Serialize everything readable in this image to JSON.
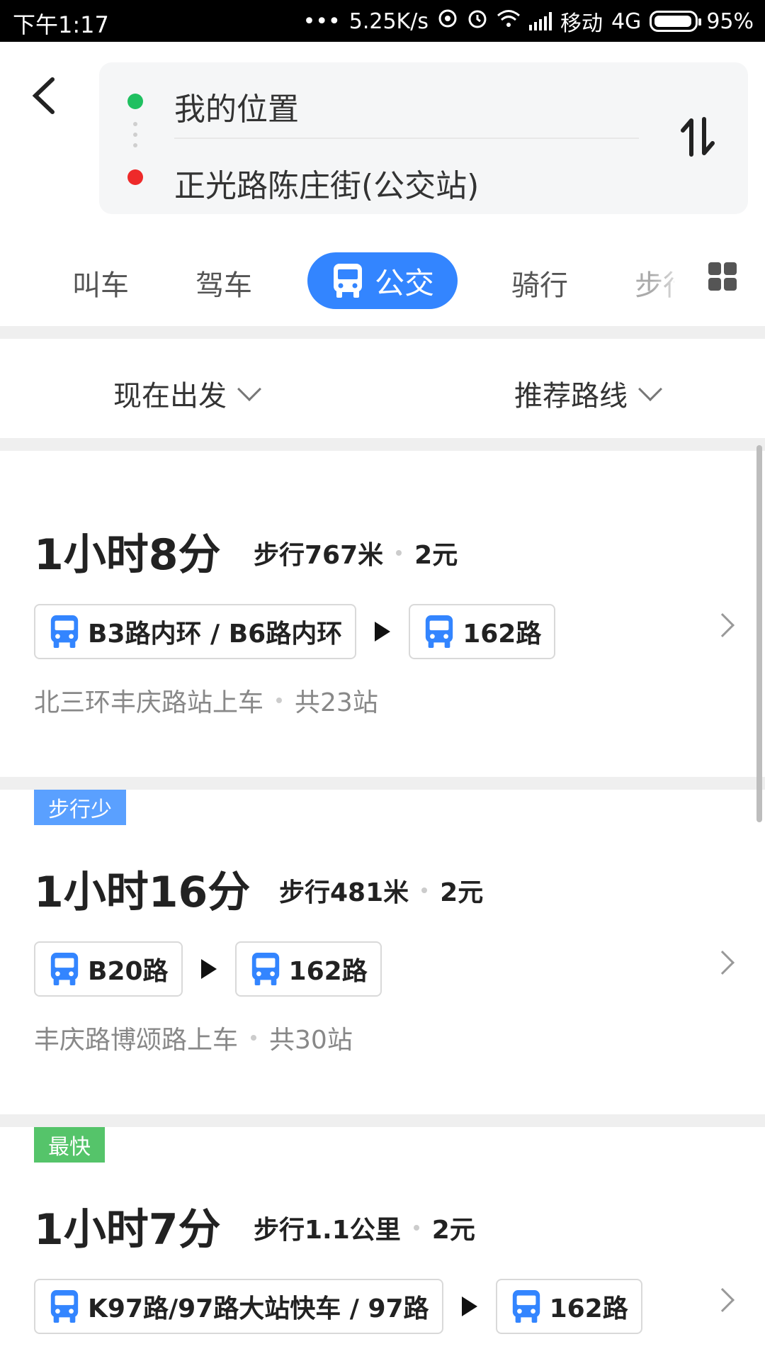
{
  "status_bar": {
    "time": "下午1:17",
    "dots": "•••",
    "speed": "5.25K/s",
    "carrier": "移动",
    "network": "4G",
    "battery": "95%"
  },
  "route": {
    "from": "我的位置",
    "to": "正光路陈庄街(公交站)"
  },
  "mode_tabs": [
    {
      "label": "叫车"
    },
    {
      "label": "驾车"
    },
    {
      "label": "公交"
    },
    {
      "label": "骑行"
    },
    {
      "label": "步行"
    }
  ],
  "filters": {
    "depart": "现在出发",
    "strategy": "推荐路线"
  },
  "routes": [
    {
      "tag": "",
      "duration": "1小时8分",
      "walk": "步行767米",
      "price": "2元",
      "lines": [
        "B3路内环 / B6路内环",
        "162路"
      ],
      "board": "北三环丰庆路站上车",
      "stops": "共23站"
    },
    {
      "tag": "步行少",
      "duration": "1小时16分",
      "walk": "步行481米",
      "price": "2元",
      "lines": [
        "B20路",
        "162路"
      ],
      "board": "丰庆路博颂路上车",
      "stops": "共30站"
    },
    {
      "tag": "最快",
      "duration": "1小时7分",
      "walk": "步行1.1公里",
      "price": "2元",
      "lines": [
        "K97路/97路大站快车 / 97路",
        "162路"
      ],
      "board": "",
      "stops": ""
    }
  ],
  "colors": {
    "accent": "#3385ff",
    "tag_blue": "#5aa0ff",
    "tag_green": "#55c46a",
    "origin_dot": "#1fc060",
    "dest_dot": "#ee2a2a"
  }
}
